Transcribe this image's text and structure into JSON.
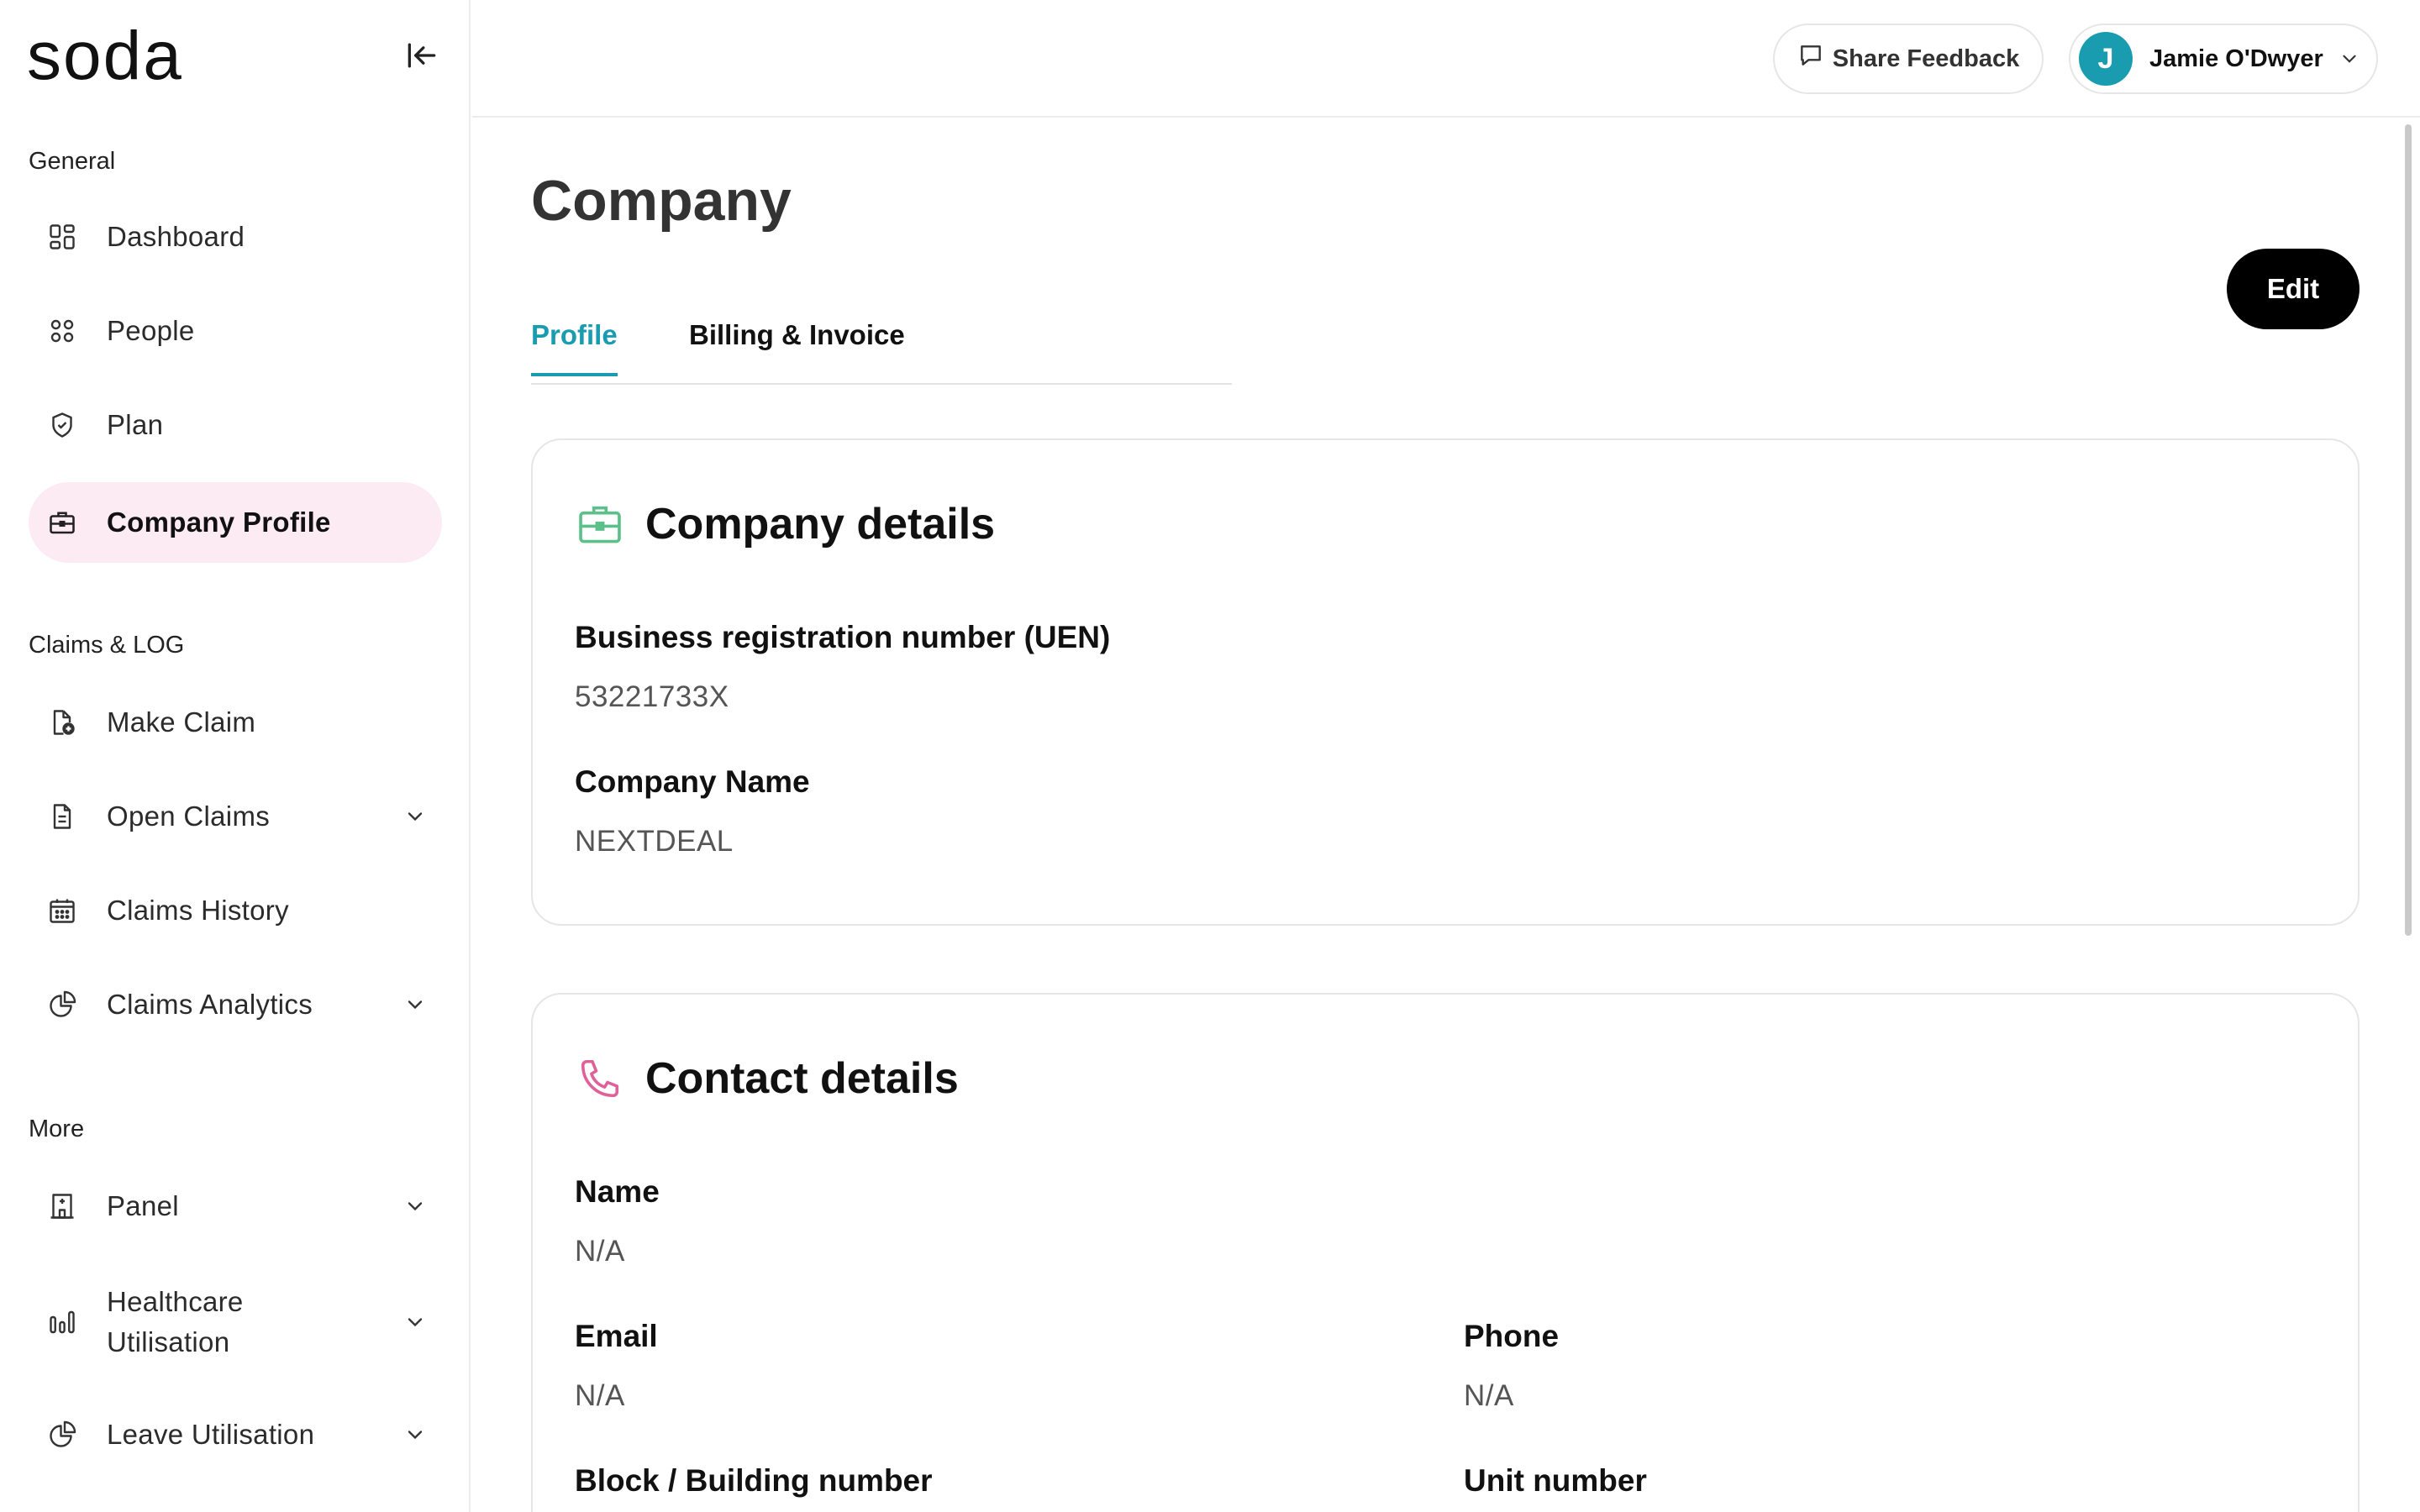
{
  "app": {
    "logo": "soda"
  },
  "sidebar": {
    "sections": [
      {
        "label": "General"
      },
      {
        "label": "Claims & LOG"
      },
      {
        "label": "More"
      }
    ],
    "items": [
      {
        "label": "Dashboard",
        "icon": "dashboard-icon"
      },
      {
        "label": "People",
        "icon": "people-icon"
      },
      {
        "label": "Plan",
        "icon": "shield-icon"
      },
      {
        "label": "Company Profile",
        "icon": "briefcase-icon",
        "active": true
      },
      {
        "label": "Make Claim",
        "icon": "file-plus-icon"
      },
      {
        "label": "Open Claims",
        "icon": "document-icon",
        "expandable": true
      },
      {
        "label": "Claims History",
        "icon": "calendar-icon"
      },
      {
        "label": "Claims Analytics",
        "icon": "pie-chart-icon",
        "expandable": true
      },
      {
        "label": "Panel",
        "icon": "building-icon",
        "expandable": true
      },
      {
        "label": "Healthcare Utilisation",
        "icon": "bar-chart-icon",
        "expandable": true
      },
      {
        "label": "Leave Utilisation",
        "icon": "pie-chart-icon",
        "expandable": true
      }
    ]
  },
  "header": {
    "feedback_label": "Share Feedback",
    "user": {
      "initial": "J",
      "name": "Jamie O'Dwyer"
    }
  },
  "main": {
    "title": "Company",
    "tabs": [
      {
        "label": "Profile",
        "active": true
      },
      {
        "label": "Billing & Invoice"
      }
    ],
    "edit_label": "Edit",
    "company_details": {
      "title": "Company details",
      "uen_label": "Business registration number (UEN)",
      "uen_value": "53221733X",
      "name_label": "Company Name",
      "name_value": "NEXTDEAL"
    },
    "contact_details": {
      "title": "Contact details",
      "name_label": "Name",
      "name_value": "N/A",
      "email_label": "Email",
      "email_value": "N/A",
      "phone_label": "Phone",
      "phone_value": "N/A",
      "block_label": "Block / Building number",
      "unit_label": "Unit number"
    }
  },
  "colors": {
    "accent": "#1a9cb0",
    "active_nav_bg": "#fdebf3",
    "briefcase_icon": "#5cc08a",
    "phone_icon": "#e0609a"
  }
}
